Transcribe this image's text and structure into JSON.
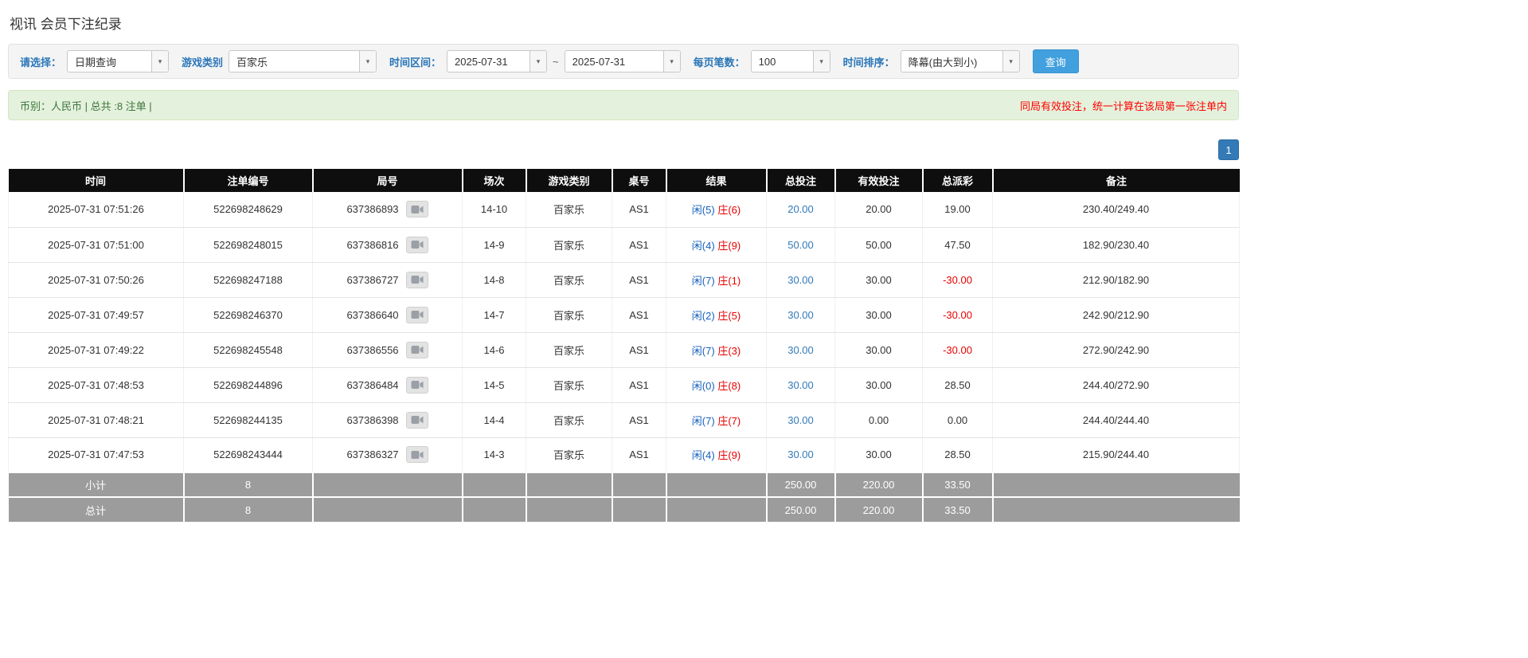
{
  "page": {
    "title": "视讯 会员下注纪录"
  },
  "colors": {
    "accent_blue": "#337ab7",
    "button_blue": "#41a0dd",
    "label_blue": "#2a76b8",
    "success_bg": "#e4f1dc",
    "success_text": "#3c763d",
    "alert_red": "#ff0000",
    "banker_red": "#e60000",
    "player_blue": "#1560bd",
    "header_black": "#0e0e0e",
    "footer_gray": "#9c9c9c"
  },
  "icons": {
    "combo_caret": "chevron-down-icon",
    "round_action": "video-icon"
  },
  "filters": {
    "select_label": "请选择：",
    "select_value": "日期查询",
    "game_label": "游戏类别",
    "game_value": "百家乐",
    "range_label": "时间区间：",
    "date_from": "2025-07-31",
    "tilde": "~",
    "date_to": "2025-07-31",
    "per_page_label": "每页笔数：",
    "per_page_value": "100",
    "sort_label": "时间排序：",
    "sort_value": "降幕(由大到小)",
    "search_button": "查询"
  },
  "summary": {
    "left": "币别：人民币 | 总共 :8 注单 |",
    "right": "同局有效投注，统一计算在该局第一张注单内"
  },
  "pagination": {
    "current_page": "1"
  },
  "table": {
    "headers": [
      "时间",
      "注单编号",
      "局号",
      "场次",
      "游戏类别",
      "桌号",
      "结果",
      "总投注",
      "有效投注",
      "总派彩",
      "备注"
    ],
    "rows": [
      {
        "time": "2025-07-31 07:51:26",
        "bet_id": "522698248629",
        "round_id": "637386893",
        "session": "14-10",
        "game": "百家乐",
        "table_no": "AS1",
        "result_player": "闲(5)",
        "result_banker": "庄(6)",
        "total_bet": "20.00",
        "valid_bet": "20.00",
        "payout": "19.00",
        "remark": "230.40/249.40"
      },
      {
        "time": "2025-07-31 07:51:00",
        "bet_id": "522698248015",
        "round_id": "637386816",
        "session": "14-9",
        "game": "百家乐",
        "table_no": "AS1",
        "result_player": "闲(4)",
        "result_banker": "庄(9)",
        "total_bet": "50.00",
        "valid_bet": "50.00",
        "payout": "47.50",
        "remark": "182.90/230.40"
      },
      {
        "time": "2025-07-31 07:50:26",
        "bet_id": "522698247188",
        "round_id": "637386727",
        "session": "14-8",
        "game": "百家乐",
        "table_no": "AS1",
        "result_player": "闲(7)",
        "result_banker": "庄(1)",
        "total_bet": "30.00",
        "valid_bet": "30.00",
        "payout": "-30.00",
        "remark": "212.90/182.90"
      },
      {
        "time": "2025-07-31 07:49:57",
        "bet_id": "522698246370",
        "round_id": "637386640",
        "session": "14-7",
        "game": "百家乐",
        "table_no": "AS1",
        "result_player": "闲(2)",
        "result_banker": "庄(5)",
        "total_bet": "30.00",
        "valid_bet": "30.00",
        "payout": "-30.00",
        "remark": "242.90/212.90"
      },
      {
        "time": "2025-07-31 07:49:22",
        "bet_id": "522698245548",
        "round_id": "637386556",
        "session": "14-6",
        "game": "百家乐",
        "table_no": "AS1",
        "result_player": "闲(7)",
        "result_banker": "庄(3)",
        "total_bet": "30.00",
        "valid_bet": "30.00",
        "payout": "-30.00",
        "remark": "272.90/242.90"
      },
      {
        "time": "2025-07-31 07:48:53",
        "bet_id": "522698244896",
        "round_id": "637386484",
        "session": "14-5",
        "game": "百家乐",
        "table_no": "AS1",
        "result_player": "闲(0)",
        "result_banker": "庄(8)",
        "total_bet": "30.00",
        "valid_bet": "30.00",
        "payout": "28.50",
        "remark": "244.40/272.90"
      },
      {
        "time": "2025-07-31 07:48:21",
        "bet_id": "522698244135",
        "round_id": "637386398",
        "session": "14-4",
        "game": "百家乐",
        "table_no": "AS1",
        "result_player": "闲(7)",
        "result_banker": "庄(7)",
        "total_bet": "30.00",
        "valid_bet": "0.00",
        "payout": "0.00",
        "remark": "244.40/244.40"
      },
      {
        "time": "2025-07-31 07:47:53",
        "bet_id": "522698243444",
        "round_id": "637386327",
        "session": "14-3",
        "game": "百家乐",
        "table_no": "AS1",
        "result_player": "闲(4)",
        "result_banker": "庄(9)",
        "total_bet": "30.00",
        "valid_bet": "30.00",
        "payout": "28.50",
        "remark": "215.90/244.40"
      }
    ],
    "subtotal": {
      "label": "小计",
      "count": "8",
      "total_bet": "250.00",
      "valid_bet": "220.00",
      "payout": "33.50"
    },
    "total": {
      "label": "总计",
      "count": "8",
      "total_bet": "250.00",
      "valid_bet": "220.00",
      "payout": "33.50"
    }
  }
}
